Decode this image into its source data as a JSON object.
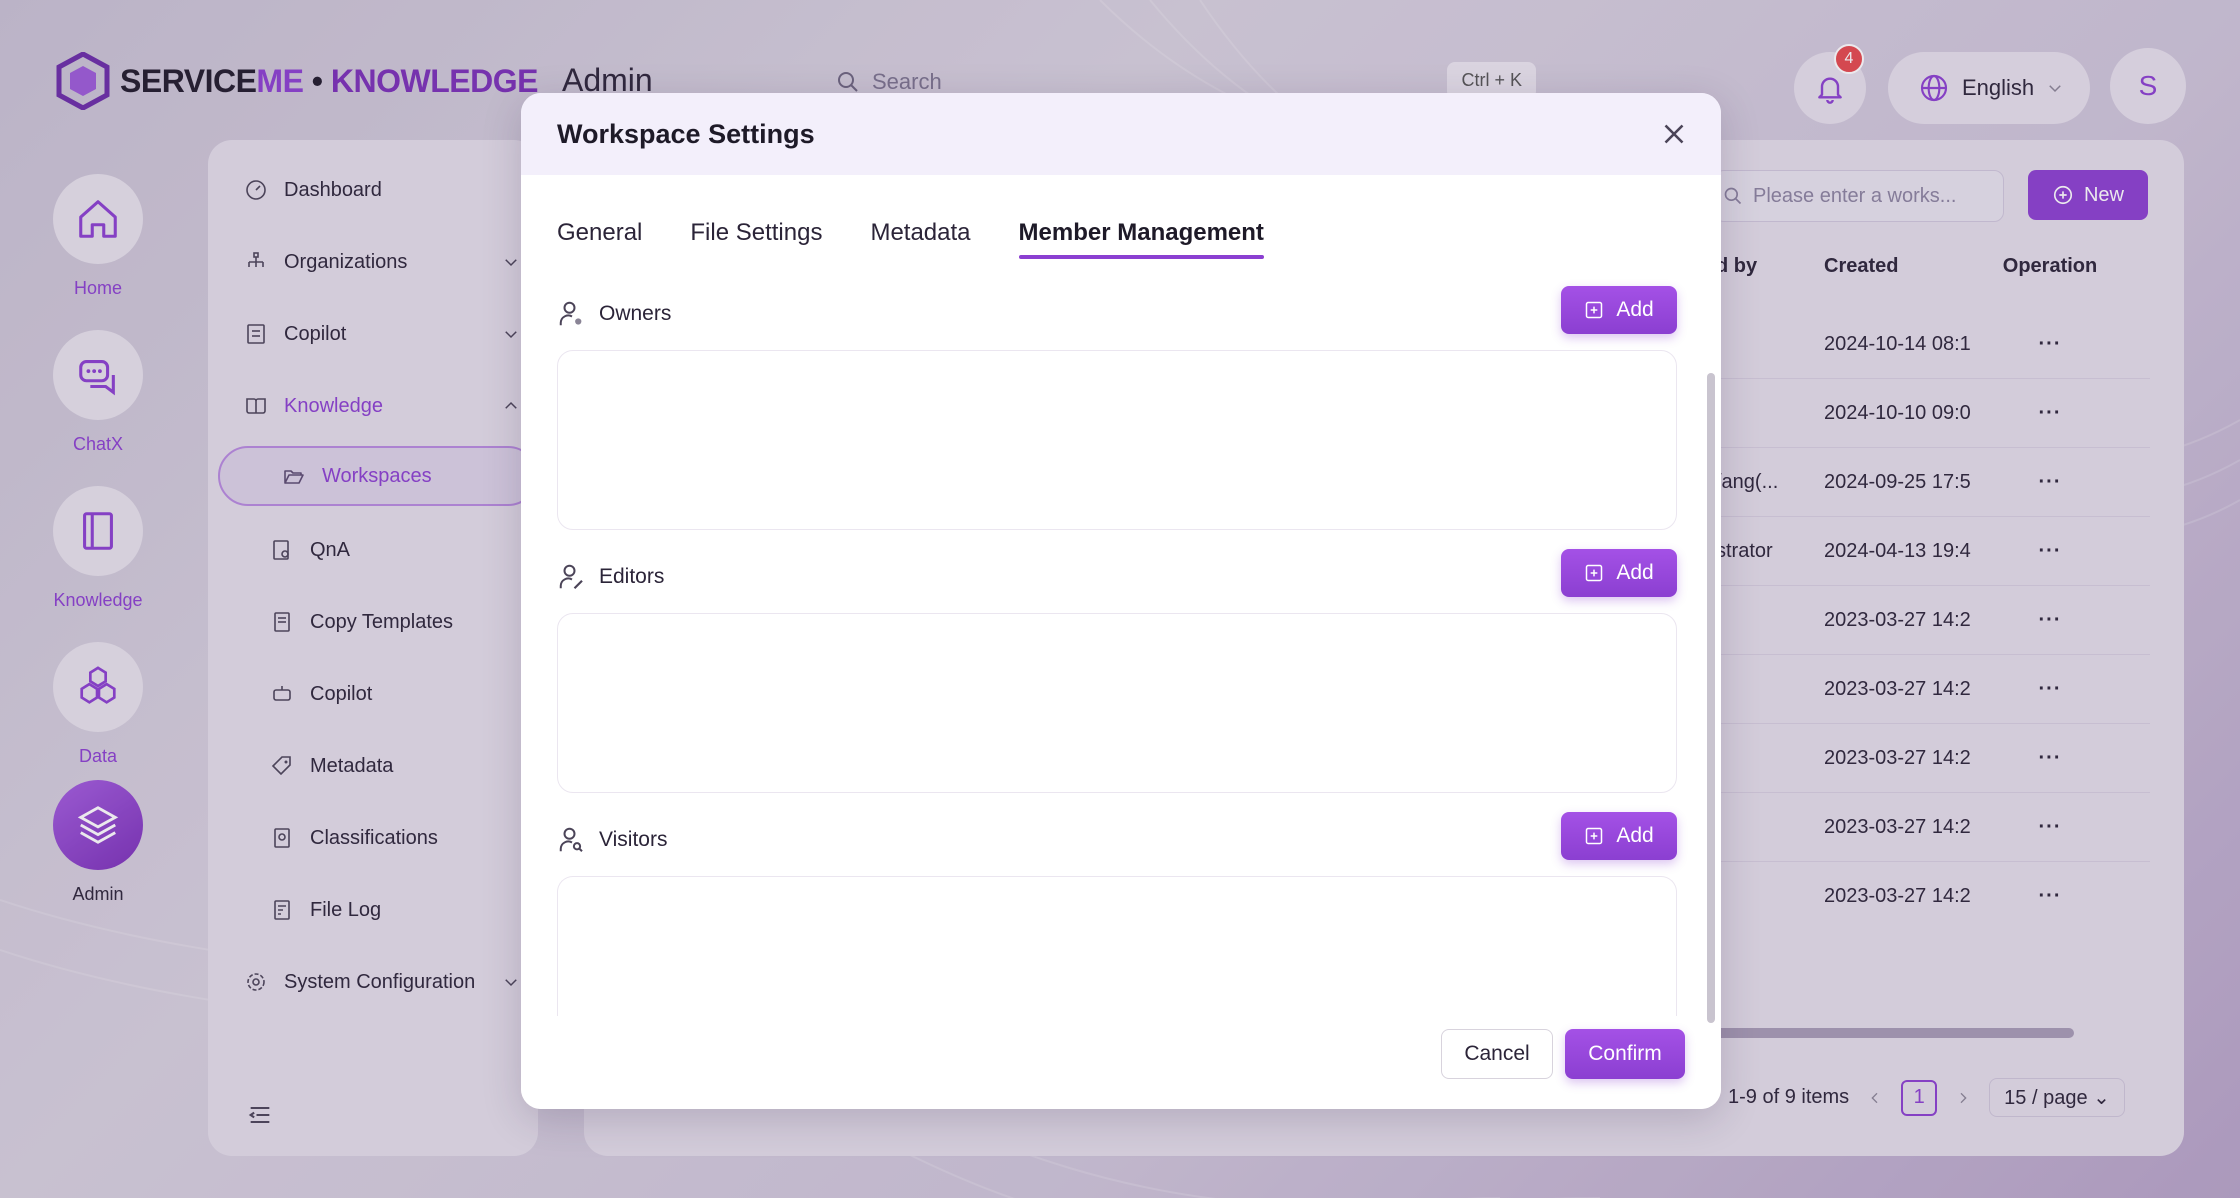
{
  "colors": {
    "accent": "#8b3fd1",
    "badge": "#e5484d"
  },
  "brand": {
    "part1": "SERVICE",
    "part2": "ME",
    "separator": " • ",
    "part3": "KNOWLEDGE"
  },
  "header": {
    "title": "Admin",
    "search_placeholder": "Search",
    "search_shortcut": "Ctrl + K",
    "notifications_count": "4",
    "language": "English",
    "user_initial": "S"
  },
  "rail": {
    "items": [
      {
        "label": "Home",
        "icon": "home-icon"
      },
      {
        "label": "ChatX",
        "icon": "chat-icon"
      },
      {
        "label": "Knowledge",
        "icon": "book-icon"
      },
      {
        "label": "Data",
        "icon": "hexagons-icon"
      },
      {
        "label": "Admin",
        "icon": "layers-icon"
      }
    ]
  },
  "sidebar": {
    "items": [
      {
        "label": "Dashboard"
      },
      {
        "label": "Organizations"
      },
      {
        "label": "Copilot"
      },
      {
        "label": "Knowledge"
      },
      {
        "label": "Workspaces"
      },
      {
        "label": "QnA"
      },
      {
        "label": "Copy Templates"
      },
      {
        "label": "Copilot"
      },
      {
        "label": "Metadata"
      },
      {
        "label": "Classifications"
      },
      {
        "label": "File Log"
      },
      {
        "label": "System Configuration"
      }
    ]
  },
  "main": {
    "search_placeholder": "Please enter a works...",
    "new_label": "New",
    "columns": {
      "by": "d by",
      "created": "Created",
      "operation": "Operation"
    },
    "rows": [
      {
        "by": "",
        "created": "2024-10-14 08:1",
        "op": "···"
      },
      {
        "by": "",
        "created": "2024-10-10 09:0",
        "op": "···"
      },
      {
        "by": "/ang(...",
        "created": "2024-09-25 17:5",
        "op": "···"
      },
      {
        "by": "strator",
        "created": "2024-04-13 19:4",
        "op": "···"
      },
      {
        "by": "",
        "created": "2023-03-27 14:2",
        "op": "···"
      },
      {
        "by": "",
        "created": "2023-03-27 14:2",
        "op": "···"
      },
      {
        "by": "",
        "created": "2023-03-27 14:2",
        "op": "···"
      },
      {
        "by": "",
        "created": "2023-03-27 14:2",
        "op": "···"
      },
      {
        "by": "",
        "created": "2023-03-27 14:2",
        "op": "···"
      }
    ],
    "pagination": {
      "summary": "1-9 of 9 items",
      "page": "1",
      "page_size": "15 / page"
    }
  },
  "modal": {
    "title": "Workspace Settings",
    "tabs": [
      "General",
      "File Settings",
      "Metadata",
      "Member Management"
    ],
    "sections": [
      {
        "label": "Owners",
        "add_label": "Add"
      },
      {
        "label": "Editors",
        "add_label": "Add"
      },
      {
        "label": "Visitors",
        "add_label": "Add"
      }
    ],
    "cancel_label": "Cancel",
    "confirm_label": "Confirm"
  }
}
